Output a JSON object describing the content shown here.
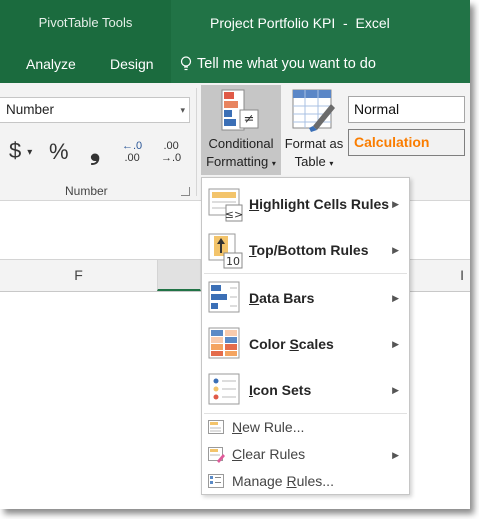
{
  "titlebar": {
    "context_tools": "PivotTable Tools",
    "window_title": "Project Portfolio KPI  -  Excel",
    "accent": "#217346"
  },
  "tabs": [
    {
      "label": "Analyze"
    },
    {
      "label": "Design"
    }
  ],
  "tell_me": "Tell me what you want to do",
  "ribbon": {
    "number_format": "Number",
    "currency_symbol": "$",
    "percent_symbol": "%",
    "comma_symbol": "❟",
    "inc_decimal_top": "←.0",
    "inc_decimal_bottom": ".00",
    "dec_decimal_top": ".00",
    "dec_decimal_bottom": "→.0",
    "number_group_label": "Number",
    "conditional_formatting_line1": "Conditional",
    "conditional_formatting_line2": "Formatting",
    "format_as_table_line1": "Format as",
    "format_as_table_line2": "Table",
    "cell_styles": [
      {
        "label": "Normal"
      },
      {
        "label": "Calculation",
        "color": "#fa7d00"
      }
    ]
  },
  "columns": {
    "f": "F",
    "i": "I"
  },
  "menu": {
    "big_items": [
      {
        "icon": "highlight-cells-rules-icon",
        "label": "Highlight Cells Rules",
        "underline_index": 0
      },
      {
        "icon": "top-bottom-rules-icon",
        "label": "Top/Bottom Rules",
        "underline_index": 0
      },
      {
        "icon": "data-bars-icon",
        "label": "Data Bars",
        "underline_index": 0
      },
      {
        "icon": "color-scales-icon",
        "label": "Color Scales",
        "underline_index": 6
      },
      {
        "icon": "icon-sets-icon",
        "label": "Icon Sets",
        "underline_index": 0
      }
    ],
    "small_items": [
      {
        "icon": "new-rule-icon",
        "label": "New Rule...",
        "underline_index": 0
      },
      {
        "icon": "clear-rules-icon",
        "label": "Clear Rules",
        "underline_index": 0
      },
      {
        "icon": "manage-rules-icon",
        "label": "Manage Rules...",
        "underline_index": 7
      }
    ]
  }
}
